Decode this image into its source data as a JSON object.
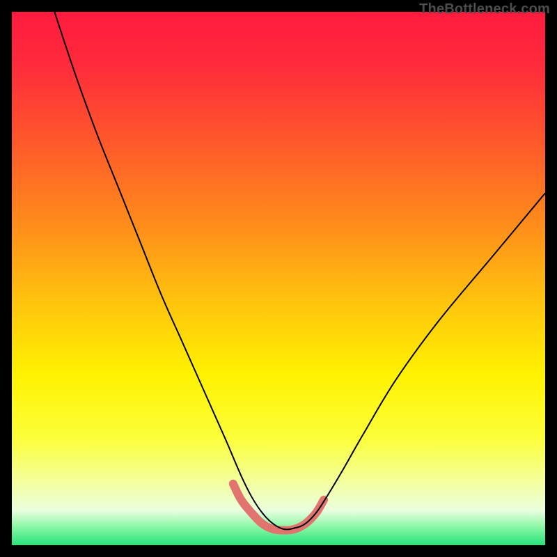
{
  "watermark": "TheBottleneck.com",
  "chart_data": {
    "type": "line",
    "title": "",
    "xlabel": "",
    "ylabel": "",
    "xlim": [
      0,
      100
    ],
    "ylim": [
      0,
      100
    ],
    "grid": false,
    "legend": false,
    "background": {
      "type": "vertical-gradient",
      "stops": [
        {
          "pos": 0.0,
          "color": "#ff1a3f"
        },
        {
          "pos": 0.1,
          "color": "#ff2b3b"
        },
        {
          "pos": 0.25,
          "color": "#ff5a2a"
        },
        {
          "pos": 0.4,
          "color": "#ff8d1b"
        },
        {
          "pos": 0.55,
          "color": "#ffc60d"
        },
        {
          "pos": 0.68,
          "color": "#fff200"
        },
        {
          "pos": 0.8,
          "color": "#fcff3a"
        },
        {
          "pos": 0.88,
          "color": "#f4ff9c"
        },
        {
          "pos": 0.935,
          "color": "#eaffdf"
        },
        {
          "pos": 0.965,
          "color": "#8cf7a7"
        },
        {
          "pos": 1.0,
          "color": "#27e37a"
        }
      ]
    },
    "series": [
      {
        "name": "bottleneck-curve",
        "stroke": "#000000",
        "stroke_width": 2,
        "x": [
          8,
          12,
          16,
          20,
          24,
          28,
          32,
          36,
          40,
          43,
          45,
          47,
          49,
          51,
          53,
          55,
          57,
          59,
          62,
          66,
          72,
          80,
          90,
          100
        ],
        "y_pct": [
          100,
          88,
          77,
          67,
          57,
          47,
          38,
          29,
          20,
          13,
          9,
          6,
          4,
          3,
          3.2,
          4,
          6,
          9,
          14,
          21,
          31,
          42,
          54,
          66
        ]
      }
    ],
    "highlight": {
      "name": "optimal-zone",
      "stroke": "#e2746f",
      "stroke_width": 12,
      "linecap": "round",
      "x": [
        41.5,
        43,
        45,
        47,
        49,
        51,
        53,
        55,
        57,
        58.5
      ],
      "y_pct": [
        11.5,
        8.5,
        6,
        4,
        3,
        2.8,
        3,
        4,
        6,
        8.5
      ]
    }
  }
}
